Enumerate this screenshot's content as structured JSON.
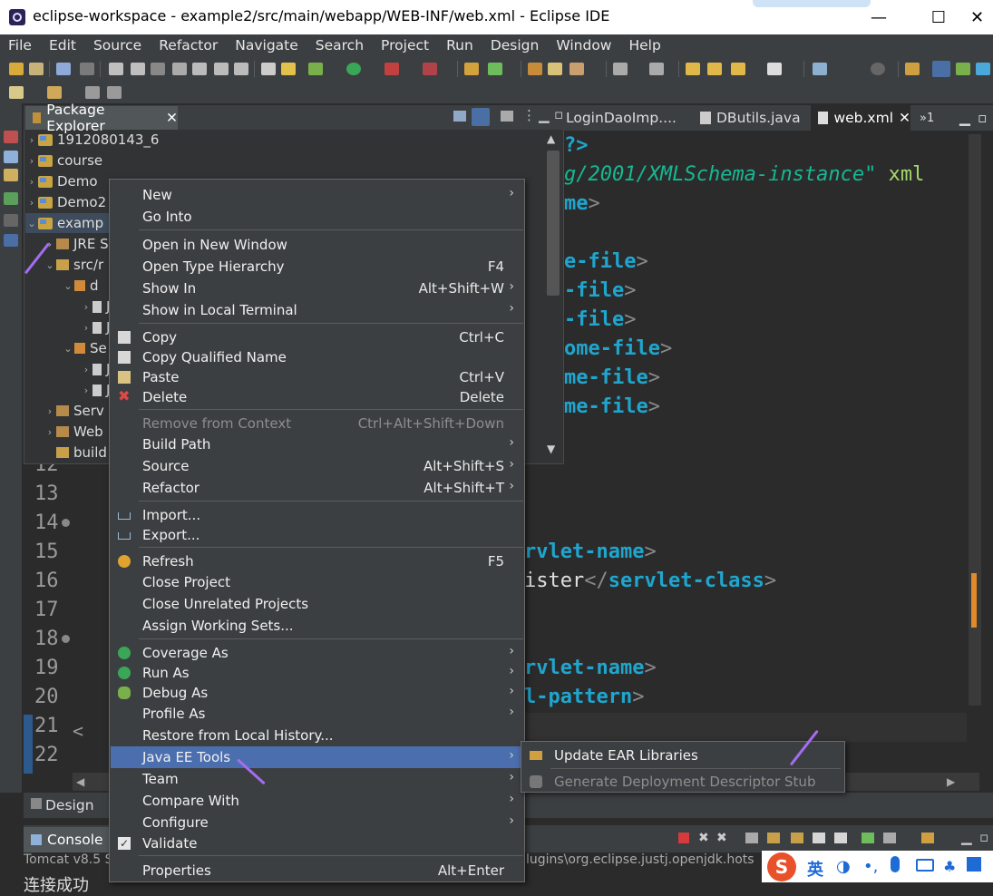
{
  "window": {
    "title": "eclipse-workspace - example2/src/main/webapp/WEB-INF/web.xml - Eclipse IDE",
    "minimize_glyph": "—",
    "maximize_glyph": "☐",
    "close_glyph": "✕"
  },
  "menubar": [
    "File",
    "Edit",
    "Source",
    "Refactor",
    "Navigate",
    "Search",
    "Project",
    "Run",
    "Design",
    "Window",
    "Help"
  ],
  "package_explorer": {
    "tab_label": "Package Explorer",
    "items": [
      {
        "label": "1912080143_6",
        "arrow": "›"
      },
      {
        "label": "course",
        "arrow": "›"
      },
      {
        "label": "Demo",
        "arrow": "›"
      },
      {
        "label": "Demo2",
        "arrow": "›"
      },
      {
        "label": "examp",
        "arrow": "⌄"
      },
      {
        "label": "JRE S",
        "arrow": "›"
      },
      {
        "label": "src/r",
        "arrow": "⌄"
      },
      {
        "label": "d",
        "arrow": "⌄"
      },
      {
        "label": "J",
        "arrow": "›"
      },
      {
        "label": "J",
        "arrow": "›"
      },
      {
        "label": "Se",
        "arrow": "⌄"
      },
      {
        "label": "J",
        "arrow": "›"
      },
      {
        "label": "J",
        "arrow": "›"
      },
      {
        "label": "Serv",
        "arrow": "›"
      },
      {
        "label": "Web",
        "arrow": "›"
      },
      {
        "label": "build",
        "arrow": ""
      }
    ]
  },
  "editor": {
    "tabs": [
      {
        "label": "LoginDaoImp....",
        "active": false
      },
      {
        "label": "DButils.java",
        "active": false
      },
      {
        "label": "web.xml",
        "active": true
      }
    ],
    "overflow_label": "»1",
    "line_numbers": [
      "12",
      "13",
      "14",
      "15",
      "16",
      "17",
      "18",
      "19",
      "20",
      "21",
      "22"
    ],
    "code_fragments": {
      "l1_a": "?>",
      "l2_a": "g/2001/XMLSchema-instance\"",
      "l2_b": " xml",
      "l3_a": "me",
      "l3_b": ">",
      "l5_a": "e-file",
      "l5_b": ">",
      "l6_a": "-file",
      "l6_b": ">",
      "l7_a": "-file",
      "l7_b": ">",
      "l8_a": "ome-file",
      "l8_b": ">",
      "l9_a": "me-file",
      "l9_b": ">",
      "l10_a": "me-file",
      "l10_b": ">",
      "l15_a": "rvlet-name",
      "l15_b": ">",
      "l16_a": "ister",
      "l16_b": "</",
      "l16_c": "servlet-class",
      "l16_d": ">",
      "l19_a": "rvlet-name",
      "l19_b": ">",
      "l20_a": "l-pattern",
      "l20_b": ">",
      "gutter_bracket": "<"
    }
  },
  "bottom": {
    "design_tab": "Design",
    "console_tab": "Console",
    "console_line": "Tomcat v8.5 S",
    "console_path": "lugins\\org.eclipse.justj.openjdk.hots",
    "console_cut": "连接成功"
  },
  "context_menu": {
    "items": [
      {
        "label": "New",
        "shortcut": "",
        "submenu": true,
        "disabled": false,
        "icon": ""
      },
      {
        "label": "Go Into",
        "shortcut": "",
        "submenu": false,
        "disabled": false,
        "icon": ""
      },
      {
        "label": "Open in New Window",
        "shortcut": "",
        "submenu": false,
        "disabled": false,
        "icon": ""
      },
      {
        "label": "Open Type Hierarchy",
        "shortcut": "F4",
        "submenu": false,
        "disabled": false,
        "icon": ""
      },
      {
        "label": "Show In",
        "shortcut": "Alt+Shift+W",
        "submenu": true,
        "disabled": false,
        "icon": ""
      },
      {
        "label": "Show in Local Terminal",
        "shortcut": "",
        "submenu": true,
        "disabled": false,
        "icon": ""
      },
      {
        "label": "Copy",
        "shortcut": "Ctrl+C",
        "submenu": false,
        "disabled": false,
        "icon": "copy-icon"
      },
      {
        "label": "Copy Qualified Name",
        "shortcut": "",
        "submenu": false,
        "disabled": false,
        "icon": "copy-icon"
      },
      {
        "label": "Paste",
        "shortcut": "Ctrl+V",
        "submenu": false,
        "disabled": false,
        "icon": "paste-icon"
      },
      {
        "label": "Delete",
        "shortcut": "Delete",
        "submenu": false,
        "disabled": false,
        "icon": "delete-icon"
      },
      {
        "label": "Remove from Context",
        "shortcut": "Ctrl+Alt+Shift+Down",
        "submenu": false,
        "disabled": true,
        "icon": ""
      },
      {
        "label": "Build Path",
        "shortcut": "",
        "submenu": true,
        "disabled": false,
        "icon": ""
      },
      {
        "label": "Source",
        "shortcut": "Alt+Shift+S",
        "submenu": true,
        "disabled": false,
        "icon": ""
      },
      {
        "label": "Refactor",
        "shortcut": "Alt+Shift+T",
        "submenu": true,
        "disabled": false,
        "icon": ""
      },
      {
        "label": "Import...",
        "shortcut": "",
        "submenu": false,
        "disabled": false,
        "icon": "import-icon"
      },
      {
        "label": "Export...",
        "shortcut": "",
        "submenu": false,
        "disabled": false,
        "icon": "export-icon"
      },
      {
        "label": "Refresh",
        "shortcut": "F5",
        "submenu": false,
        "disabled": false,
        "icon": "refresh-icon"
      },
      {
        "label": "Close Project",
        "shortcut": "",
        "submenu": false,
        "disabled": false,
        "icon": ""
      },
      {
        "label": "Close Unrelated Projects",
        "shortcut": "",
        "submenu": false,
        "disabled": false,
        "icon": ""
      },
      {
        "label": "Assign Working Sets...",
        "shortcut": "",
        "submenu": false,
        "disabled": false,
        "icon": ""
      },
      {
        "label": "Coverage As",
        "shortcut": "",
        "submenu": true,
        "disabled": false,
        "icon": "coverage-icon"
      },
      {
        "label": "Run As",
        "shortcut": "",
        "submenu": true,
        "disabled": false,
        "icon": "run-icon"
      },
      {
        "label": "Debug As",
        "shortcut": "",
        "submenu": true,
        "disabled": false,
        "icon": "debug-icon"
      },
      {
        "label": "Profile As",
        "shortcut": "",
        "submenu": true,
        "disabled": false,
        "icon": ""
      },
      {
        "label": "Restore from Local History...",
        "shortcut": "",
        "submenu": false,
        "disabled": false,
        "icon": ""
      },
      {
        "label": "Java EE Tools",
        "shortcut": "",
        "submenu": true,
        "disabled": false,
        "icon": "",
        "highlighted": true
      },
      {
        "label": "Team",
        "shortcut": "",
        "submenu": true,
        "disabled": false,
        "icon": ""
      },
      {
        "label": "Compare With",
        "shortcut": "",
        "submenu": true,
        "disabled": false,
        "icon": ""
      },
      {
        "label": "Configure",
        "shortcut": "",
        "submenu": true,
        "disabled": false,
        "icon": ""
      },
      {
        "label": "Validate",
        "shortcut": "",
        "submenu": false,
        "disabled": false,
        "icon": "checkbox-icon"
      },
      {
        "label": "Properties",
        "shortcut": "Alt+Enter",
        "submenu": false,
        "disabled": false,
        "icon": ""
      }
    ],
    "submenu_glyph": "›"
  },
  "submenu": {
    "items": [
      {
        "label": "Update EAR Libraries",
        "disabled": false
      },
      {
        "label": "Generate Deployment Descriptor Stub",
        "disabled": true
      }
    ]
  },
  "ime": {
    "label": "英",
    "sogou_letter": "S"
  },
  "colors": {
    "menu_bg": "#3c3f41",
    "highlight": "#4b6eaf",
    "annotation_arrow": "#a56cf0",
    "code_tag": "#1fa6cf",
    "code_attr": "#16b893"
  }
}
